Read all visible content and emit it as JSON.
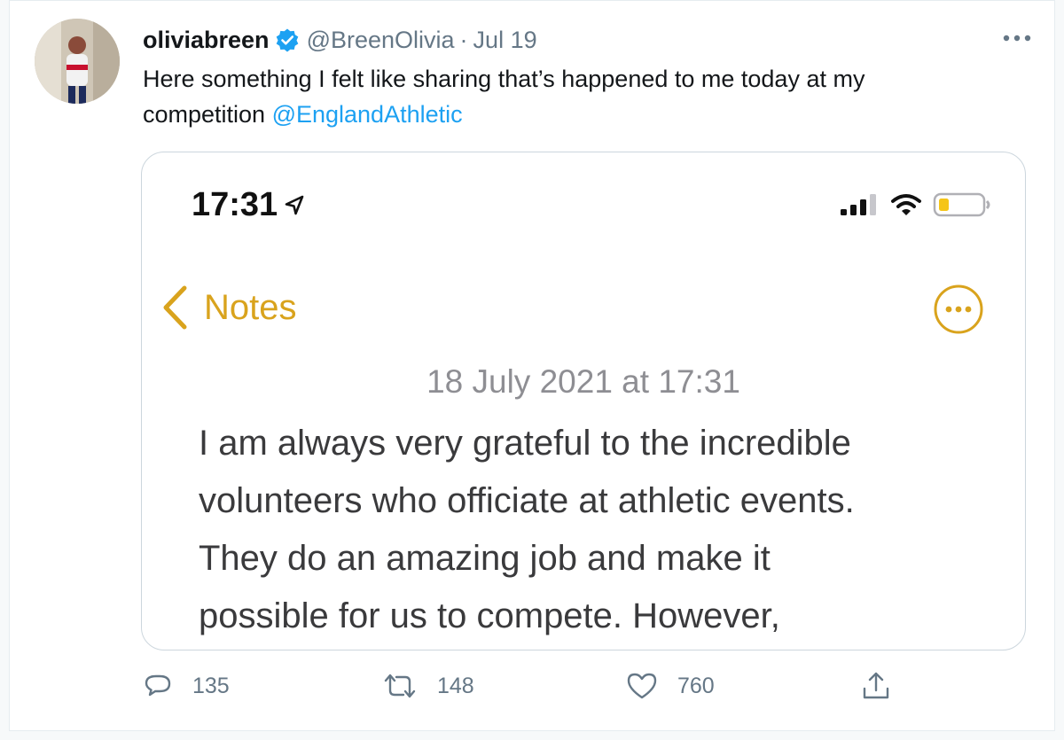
{
  "tweet": {
    "display_name": "oliviabreen",
    "handle": "@BreenOlivia",
    "separator": "·",
    "date": "Jul 19",
    "text": "Here something I felt like sharing that’s happened to me today at my competition ",
    "mention": "@EnglandAthletic"
  },
  "media": {
    "status_time": "17:31",
    "back_label": "Notes",
    "note_date": "18 July 2021 at 17:31",
    "note_lines": [
      "I am always very grateful to the incredible",
      "volunteers who officiate at athletic events.",
      "They do an amazing job and make it",
      "possible for us to compete. However,"
    ],
    "accent_color": "#d9a31d"
  },
  "actions": {
    "replies": "135",
    "retweets": "148",
    "likes": "760"
  },
  "icons": {
    "verified": "verified-badge-icon",
    "more": "more-horizontal-icon",
    "reply": "reply-icon",
    "retweet": "retweet-icon",
    "like": "heart-icon",
    "share": "share-icon"
  }
}
